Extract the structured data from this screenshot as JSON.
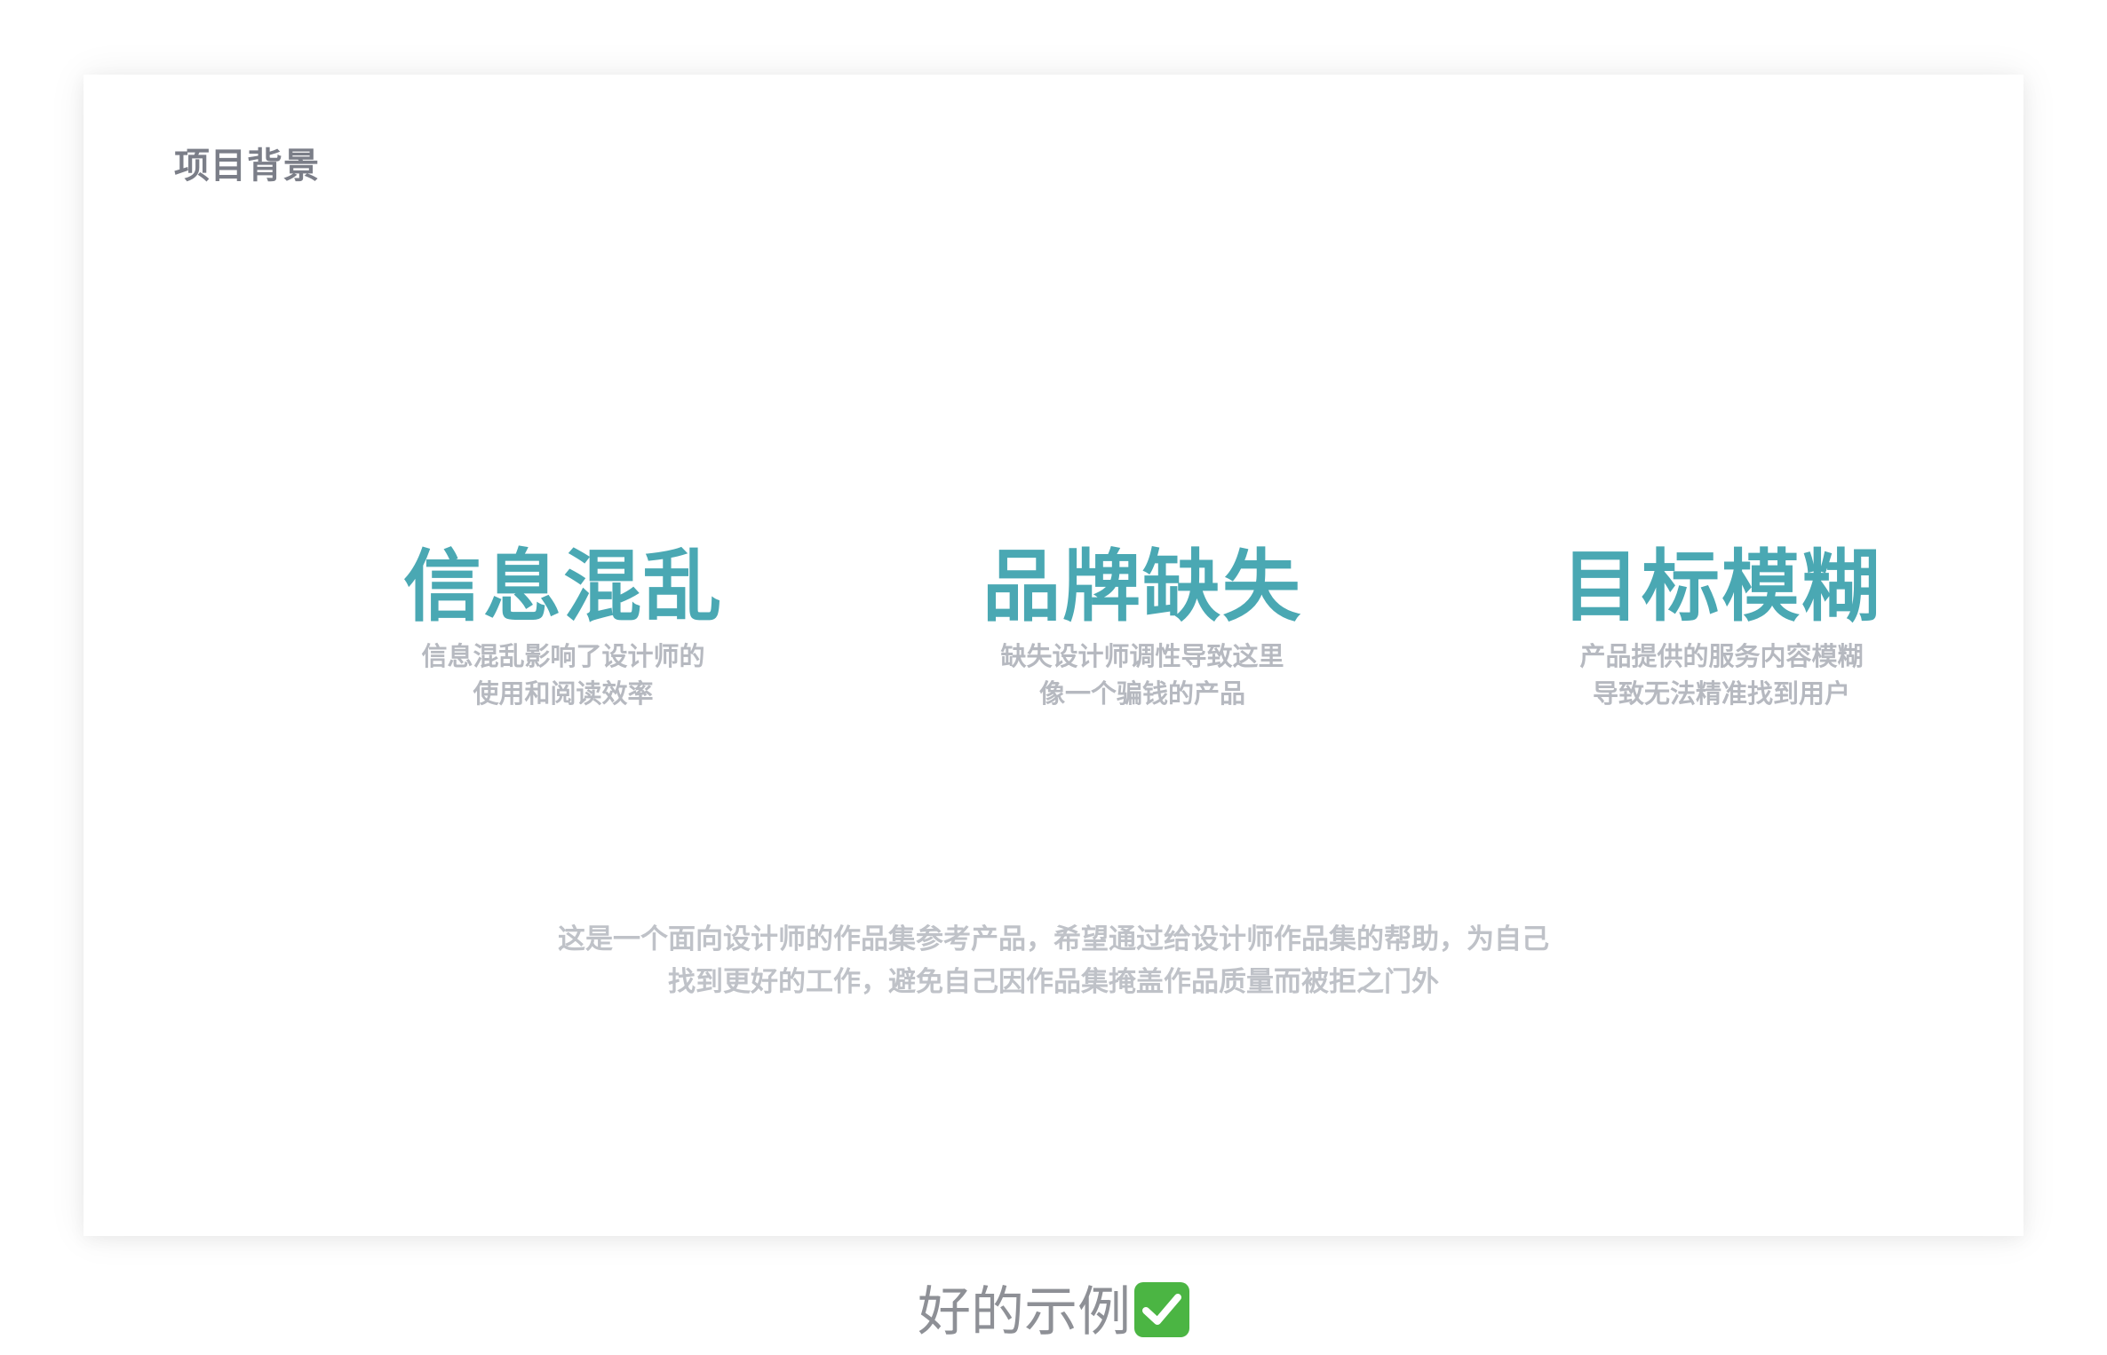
{
  "card": {
    "section_title": "项目背景",
    "features": [
      {
        "title": "信息混乱",
        "desc_line1": "信息混乱影响了设计师的",
        "desc_line2": "使用和阅读效率"
      },
      {
        "title": "品牌缺失",
        "desc_line1": "缺失设计师调性导致这里",
        "desc_line2": "像一个骗钱的产品"
      },
      {
        "title": "目标模糊",
        "desc_line1": "产品提供的服务内容模糊",
        "desc_line2": "导致无法精准找到用户"
      }
    ],
    "summary_line1": "这是一个面向设计师的作品集参考产品，希望通过给设计师作品集的帮助，为自己",
    "summary_line2": "找到更好的工作，避免自己因作品集掩盖作品质量而被拒之门外"
  },
  "caption": {
    "text": "好的示例",
    "icon": "check-mark-icon"
  },
  "colors": {
    "accent": "#4aa8b3",
    "title_gray": "#7b7e88",
    "desc_gray": "#b6b9c0",
    "check_green": "#4bb543"
  }
}
